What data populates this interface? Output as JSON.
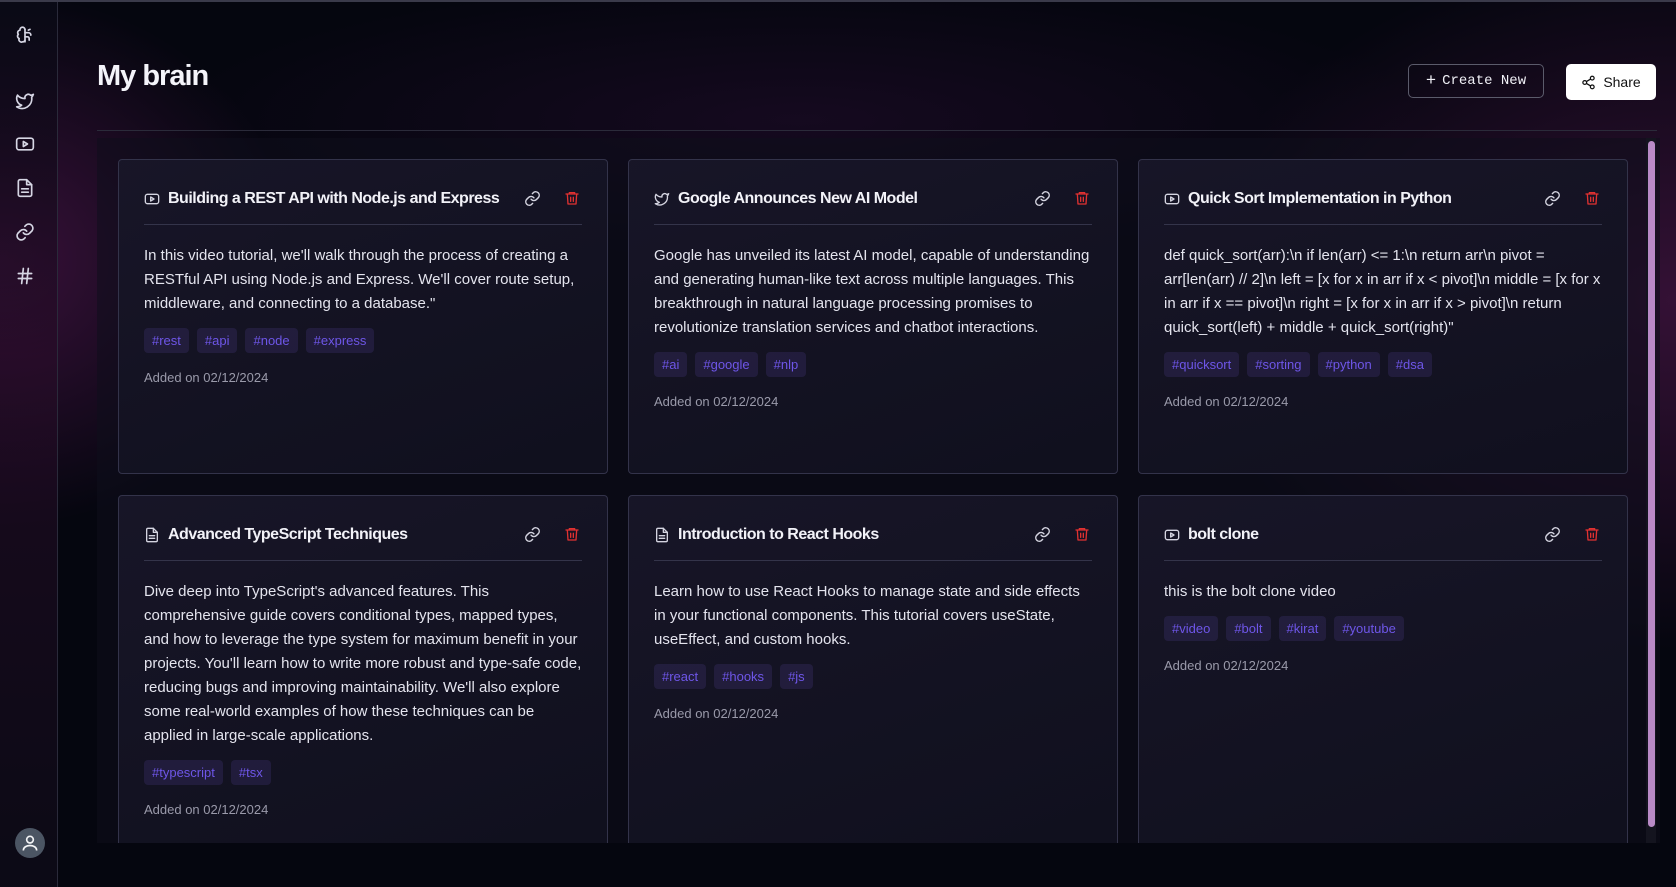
{
  "page": {
    "title": "My brain"
  },
  "header": {
    "create_label": "Create New",
    "share_label": "Share"
  },
  "sidebar": {
    "logo_icon": "brain-icon",
    "items": [
      {
        "icon": "twitter-icon"
      },
      {
        "icon": "youtube-icon"
      },
      {
        "icon": "document-icon"
      },
      {
        "icon": "link-icon"
      },
      {
        "icon": "hashtag-icon"
      }
    ],
    "avatar_icon": "user-icon"
  },
  "colors": {
    "accent_tag": "#6e56e8",
    "delete": "#e03131",
    "scrollbar": "#b98ac7"
  },
  "cards": [
    {
      "type": "youtube",
      "title": "Building a REST API with Node.js and Express",
      "body": "In this video tutorial, we'll walk through the process of creating a RESTful API using Node.js and Express. We'll cover route setup, middleware, and connecting to a database.\"",
      "tags": [
        "#rest",
        "#api",
        "#node",
        "#express"
      ],
      "date": "Added on 02/12/2024"
    },
    {
      "type": "twitter",
      "title": "Google Announces New AI Model",
      "body": "Google has unveiled its latest AI model, capable of understanding and generating human-like text across multiple languages. This breakthrough in natural language processing promises to revolutionize translation services and chatbot interactions.",
      "tags": [
        "#ai",
        "#google",
        "#nlp"
      ],
      "date": "Added on 02/12/2024"
    },
    {
      "type": "youtube",
      "title": "Quick Sort Implementation in Python",
      "body": "def quick_sort(arr):\\n if len(arr) <= 1:\\n return arr\\n pivot = arr[len(arr) // 2]\\n left = [x for x in arr if x < pivot]\\n middle = [x for x in arr if x == pivot]\\n right = [x for x in arr if x > pivot]\\n return quick_sort(left) + middle + quick_sort(right)\"",
      "tags": [
        "#quicksort",
        "#sorting",
        "#python",
        "#dsa"
      ],
      "date": "Added on 02/12/2024"
    },
    {
      "type": "document",
      "title": "Advanced TypeScript Techniques",
      "body": "Dive deep into TypeScript's advanced features. This comprehensive guide covers conditional types, mapped types, and how to leverage the type system for maximum benefit in your projects. You'll learn how to write more robust and type-safe code, reducing bugs and improving maintainability. We'll also explore some real-world examples of how these techniques can be applied in large-scale applications.",
      "tags": [
        "#typescript",
        "#tsx"
      ],
      "date": "Added on 02/12/2024"
    },
    {
      "type": "document",
      "title": "Introduction to React Hooks",
      "body": "Learn how to use React Hooks to manage state and side effects in your functional components. This tutorial covers useState, useEffect, and custom hooks.",
      "tags": [
        "#react",
        "#hooks",
        "#js"
      ],
      "date": "Added on 02/12/2024"
    },
    {
      "type": "youtube",
      "title": "bolt clone",
      "body": "this is the bolt clone video",
      "tags": [
        "#video",
        "#bolt",
        "#kirat",
        "#youtube"
      ],
      "date": "Added on 02/12/2024"
    }
  ]
}
